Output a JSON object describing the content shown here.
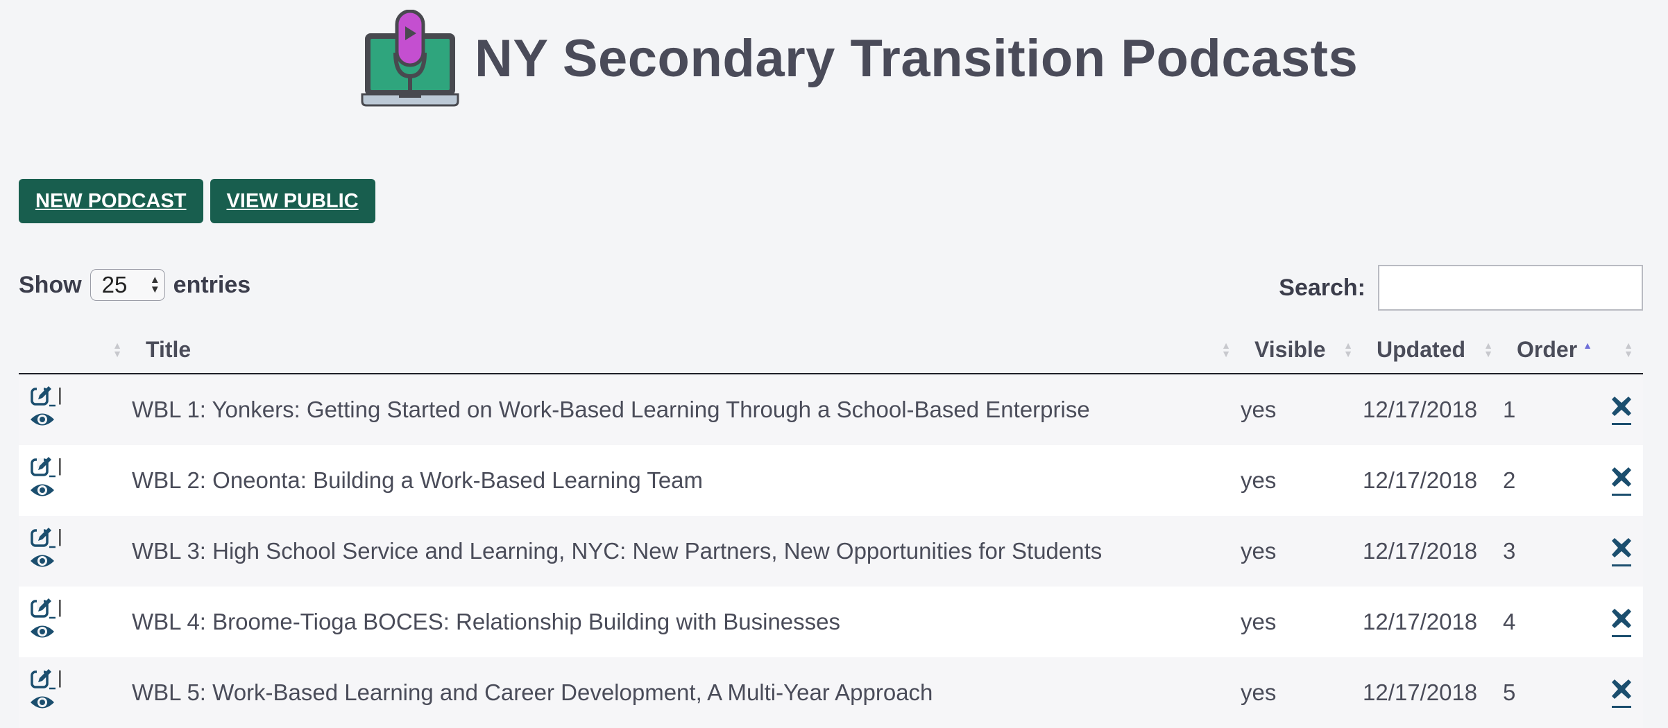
{
  "header": {
    "title": "NY Secondary Transition Podcasts",
    "logo_icon": "podcast-laptop-icon"
  },
  "toolbar": {
    "new_podcast_label": "NEW PODCAST",
    "view_public_label": "VIEW PUBLIC"
  },
  "length": {
    "show_label": "Show",
    "value": "25",
    "entries_label": "entries"
  },
  "search": {
    "label": "Search:",
    "value": "",
    "placeholder": ""
  },
  "table": {
    "columns": [
      {
        "label": ""
      },
      {
        "label": "Title"
      },
      {
        "label": "Visible"
      },
      {
        "label": "Updated"
      },
      {
        "label": "Order",
        "sorted": "asc"
      },
      {
        "label": ""
      }
    ],
    "action_separator": "|",
    "rows": [
      {
        "title": "WBL 1: Yonkers: Getting Started on Work-Based Learning Through a School-Based Enterprise",
        "visible": "yes",
        "updated": "12/17/2018",
        "order": "1"
      },
      {
        "title": "WBL 2: Oneonta: Building a Work-Based Learning Team",
        "visible": "yes",
        "updated": "12/17/2018",
        "order": "2"
      },
      {
        "title": "WBL 3: High School Service and Learning, NYC: New Partners, New Opportunities for Students",
        "visible": "yes",
        "updated": "12/17/2018",
        "order": "3"
      },
      {
        "title": "WBL 4: Broome-Tioga BOCES: Relationship Building with Businesses",
        "visible": "yes",
        "updated": "12/17/2018",
        "order": "4"
      },
      {
        "title": "WBL 5: Work-Based Learning and Career Development, A Multi-Year Approach",
        "visible": "yes",
        "updated": "12/17/2018",
        "order": "5"
      }
    ]
  },
  "colors": {
    "button_bg": "#185e4e",
    "icon_color": "#1b4e6e",
    "text": "#4a4c59"
  }
}
